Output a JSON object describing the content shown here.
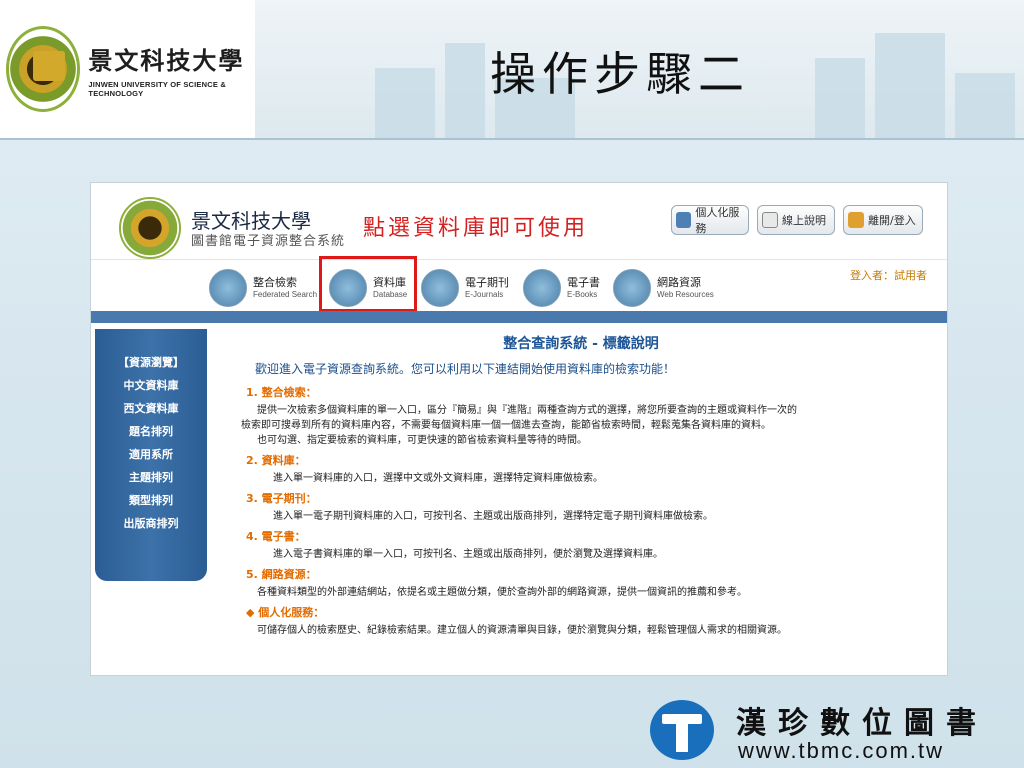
{
  "slide": {
    "title": "操作步驟二",
    "school_cn": "景文科技大學",
    "school_en": "JINWEN UNIVERSITY OF SCIENCE & TECHNOLOGY"
  },
  "site": {
    "name": "景文科技大學",
    "subtitle": "圖書館電子資源整合系統",
    "annotation": "點選資料庫即可使用",
    "top_buttons": [
      {
        "label": "個人化服務"
      },
      {
        "label": "線上說明"
      },
      {
        "label": "離開/登入"
      }
    ],
    "nav": [
      {
        "cn": "整合檢索",
        "en": "Federated Search"
      },
      {
        "cn": "資料庫",
        "en": "Database"
      },
      {
        "cn": "電子期刊",
        "en": "E-Journals"
      },
      {
        "cn": "電子書",
        "en": "E-Books"
      },
      {
        "cn": "網路資源",
        "en": "Web Resources"
      }
    ],
    "login": "登入者：試用者",
    "sidebar": [
      "【資源瀏覽】",
      "中文資料庫",
      "西文資料庫",
      "題名排列",
      "適用系所",
      "主題排列",
      "類型排列",
      "出版商排列"
    ],
    "content": {
      "title": "整合查詢系統 - 標籤說明",
      "welcome": "歡迎進入電子資源查詢系統。您可以利用以下連結開始使用資料庫的檢索功能！",
      "s1_head": "1. 整合檢索：",
      "s1_l1": "提供一次檢索多個資料庫的單一入口，區分『簡易』與『進階』兩種查詢方式的選擇，將您所要查詢的主題或資料作一次的",
      "s1_l2": "檢索即可搜尋到所有的資料庫內容，不需要每個資料庫一個一個進去查詢，能節省檢索時間，輕鬆蒐集各資料庫的資料。",
      "s1_l3": "也可勾選、指定要檢索的資料庫，可更快速的節省檢索資料量等待的時間。",
      "s2_head": "2. 資料庫：",
      "s2_l1": "進入單一資料庫的入口，選擇中文或外文資料庫，選擇特定資料庫做檢索。",
      "s3_head": "3. 電子期刊：",
      "s3_l1": "進入單一電子期刊資料庫的入口，可按刊名、主題或出版商排列，選擇特定電子期刊資料庫做檢索。",
      "s4_head": "4. 電子書：",
      "s4_l1": "進入電子書資料庫的單一入口，可按刊名、主題或出版商排列，便於瀏覽及選擇資料庫。",
      "s5_head": "5. 網路資源：",
      "s5_l1": "各種資料類型的外部連結網站，依提名或主題做分類，便於查詢外部的網路資源，提供一個資訊的推薦和參考。",
      "s6_head": "◆ 個人化服務：",
      "s6_l1": "可儲存個人的檢索歷史、紀錄檢索結果。建立個人的資源清單與目錄，便於瀏覽與分類，輕鬆管理個人需求的相關資源。"
    }
  },
  "brand": {
    "cn": "漢珍數位圖書",
    "url": "www.tbmc.com.tw"
  },
  "colors": {
    "annotation": "#d42020",
    "highlight_box": "#e01818",
    "section_heading": "#e36b00",
    "sidebar_blue": "#3c72a9",
    "brand_blue": "#1a6fbd"
  }
}
